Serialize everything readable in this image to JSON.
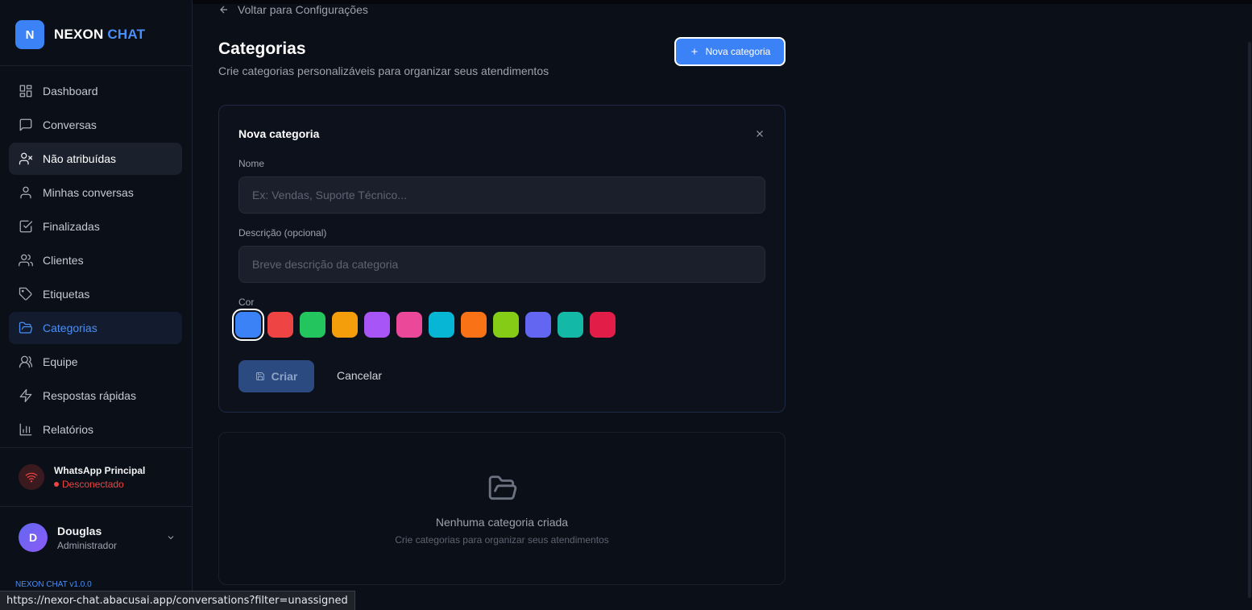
{
  "app": {
    "name_part1": "NEXON",
    "name_part2": "CHAT",
    "logo_letter": "N",
    "version": "NEXON CHAT v1.0.0"
  },
  "sidebar": {
    "items": [
      {
        "label": "Dashboard",
        "icon": "layout-grid-icon",
        "state": "normal"
      },
      {
        "label": "Conversas",
        "icon": "message-square-icon",
        "state": "normal"
      },
      {
        "label": "Não atribuídas",
        "icon": "user-x-icon",
        "state": "hover"
      },
      {
        "label": "Minhas conversas",
        "icon": "user-icon",
        "state": "normal"
      },
      {
        "label": "Finalizadas",
        "icon": "check-square-icon",
        "state": "normal"
      },
      {
        "label": "Clientes",
        "icon": "users-icon",
        "state": "normal"
      },
      {
        "label": "Etiquetas",
        "icon": "tag-icon",
        "state": "normal"
      },
      {
        "label": "Categorias",
        "icon": "folder-open-icon",
        "state": "active"
      },
      {
        "label": "Equipe",
        "icon": "users-group-icon",
        "state": "normal"
      },
      {
        "label": "Respostas rápidas",
        "icon": "zap-icon",
        "state": "normal"
      },
      {
        "label": "Relatórios",
        "icon": "bar-chart-icon",
        "state": "normal"
      }
    ],
    "whatsapp": {
      "title": "WhatsApp Principal",
      "status": "Desconectado"
    },
    "user": {
      "initial": "D",
      "name": "Douglas",
      "role": "Administrador"
    }
  },
  "main": {
    "back_label": "Voltar para Configurações",
    "title": "Categorias",
    "subtitle": "Crie categorias personalizáveis para organizar seus atendimentos",
    "new_button": "Nova categoria",
    "form": {
      "title": "Nova categoria",
      "name_label": "Nome",
      "name_placeholder": "Ex: Vendas, Suporte Técnico...",
      "desc_label": "Descrição (opcional)",
      "desc_placeholder": "Breve descrição da categoria",
      "color_label": "Cor",
      "colors": [
        "#3b82f6",
        "#ef4444",
        "#22c55e",
        "#f59e0b",
        "#a855f7",
        "#ec4899",
        "#06b6d4",
        "#f97316",
        "#84cc16",
        "#6366f1",
        "#14b8a6",
        "#e11d48"
      ],
      "selected_color_index": 0,
      "create_label": "Criar",
      "cancel_label": "Cancelar"
    },
    "empty": {
      "title": "Nenhuma categoria criada",
      "subtitle": "Crie categorias para organizar seus atendimentos"
    }
  },
  "status_url": "https://nexor-chat.abacusai.app/conversations?filter=unassigned"
}
